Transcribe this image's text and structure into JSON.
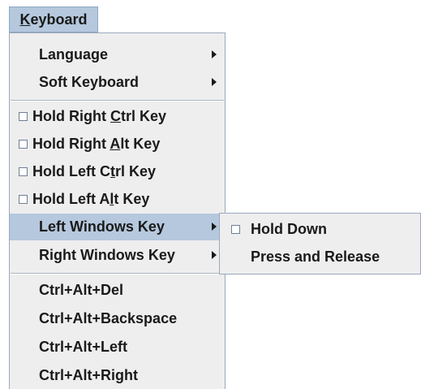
{
  "menubar": {
    "keyboard": {
      "mnemonic": "K",
      "rest": "eyboard"
    }
  },
  "menu": {
    "language": "Language",
    "soft_keyboard": "Soft Keyboard",
    "hold_right_ctrl": {
      "pre": "Hold Right ",
      "mn": "C",
      "post": "trl Key"
    },
    "hold_right_alt": {
      "pre": "Hold Right ",
      "mn": "A",
      "post": "lt Key"
    },
    "hold_left_ctrl": {
      "pre": "Hold Left C",
      "mn": "t",
      "post": "rl Key"
    },
    "hold_left_alt": {
      "pre": "Hold Left A",
      "mn": "l",
      "post": "t Key"
    },
    "left_windows_key": "Left Windows Key",
    "right_windows_key": "Right Windows Key",
    "ctrl_alt_del": "Ctrl+Alt+Del",
    "ctrl_alt_backspace": "Ctrl+Alt+Backspace",
    "ctrl_alt_left": "Ctrl+Alt+Left",
    "ctrl_alt_right": "Ctrl+Alt+Right"
  },
  "submenu": {
    "hold_down": "Hold Down",
    "press_and_release": "Press and Release"
  },
  "colors": {
    "selection": "#b5c8dd",
    "menu_background": "#eeeeee",
    "border": "#9aa9bd"
  }
}
